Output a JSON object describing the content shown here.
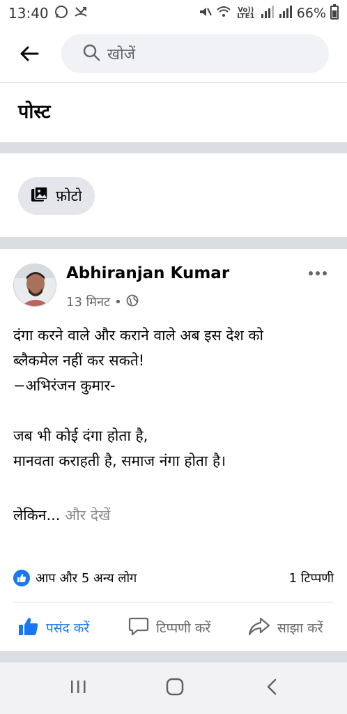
{
  "status_bar": {
    "time": "13:40",
    "network_label": "Vo)) LTE1",
    "battery": "66%"
  },
  "search": {
    "placeholder": "खोजें"
  },
  "page": {
    "title": "पोस्ट"
  },
  "filters": {
    "photo_label": "फ़ोटो"
  },
  "post": {
    "author": "Abhiranjan Kumar",
    "time_ago": "13 मिनट",
    "dot": "•",
    "body_lines": [
      "दंगा करने वाले और कराने वाले अब इस देश को",
      "ब्लैकमेल नहीं कर सकते!",
      "−अभिरंजन कुमार-",
      "",
      "जब भी कोई दंगा होता है,",
      "मानवता कराहती है, समाज नंगा होता है।",
      ""
    ],
    "truncated_text": "लेकिन...",
    "see_more": "और देखें",
    "reactions": "आप और 5 अन्य लोग",
    "comments": "1 टिप्पणी",
    "actions": {
      "like": "पसंद करें",
      "comment": "टिप्पणी करें",
      "share": "साझा करें"
    }
  },
  "colors": {
    "accent": "#1877f2",
    "secondary_text": "#65676b",
    "divider_band": "#dadde1",
    "search_bg": "#f0f2f5"
  },
  "icons": {
    "back": "back-arrow-icon",
    "search": "search-icon",
    "photo": "photo-icon",
    "globe": "globe-icon",
    "more": "more-horizontal-icon",
    "like": "thumbs-up-icon",
    "comment": "comment-bubble-icon",
    "share": "share-arrow-icon"
  }
}
